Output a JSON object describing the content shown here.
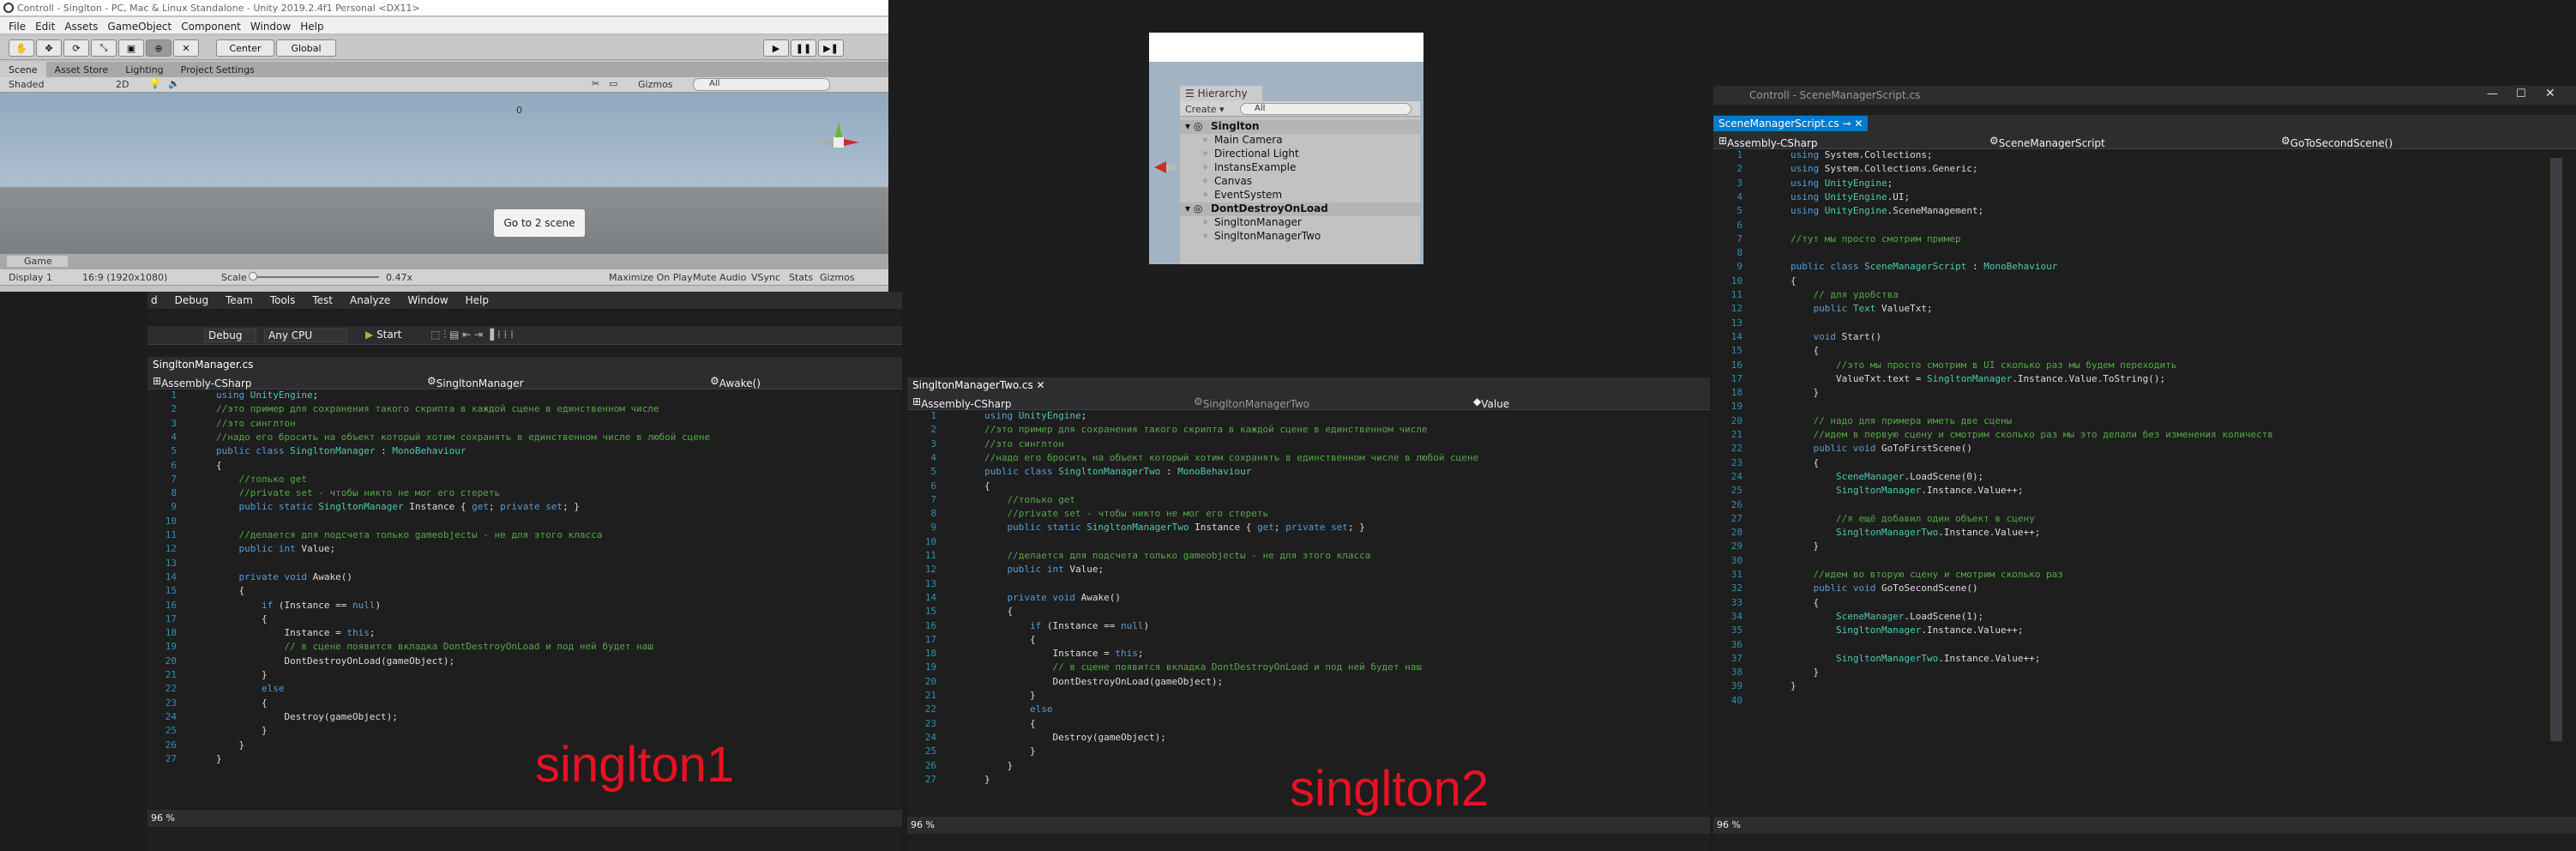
{
  "unity": {
    "title": "Controll - Singlton - PC, Mac & Linux Standalone - Unity 2019.2.4f1 Personal <DX11>",
    "menu": [
      "File",
      "Edit",
      "Assets",
      "GameObject",
      "Component",
      "Window",
      "Help"
    ],
    "toolbar": {
      "center": "Center",
      "global": "Global"
    },
    "tabs": [
      "Scene",
      "Asset Store",
      "Lighting",
      "Project Settings"
    ],
    "scene_bar": {
      "shaded": "Shaded",
      "mode2d": "2D",
      "gizmos": "Gizmos",
      "search": "All"
    },
    "scene_button": "Go to 2 scene",
    "scene_value": "0",
    "game_tab": "Game",
    "game_bar": {
      "display": "Display 1",
      "res": "16:9 (1920x1080)",
      "scale_label": "Scale",
      "scale_value": "0.47x",
      "max": "Maximize On Play",
      "mute": "Mute Audio",
      "vsync": "VSync",
      "stats": "Stats",
      "gizmos": "Gizmos"
    }
  },
  "hierarchy": {
    "title": "Hierarchy",
    "create": "Create",
    "search": "All",
    "items": [
      {
        "label": "Singlton",
        "level": 0,
        "scene": true
      },
      {
        "label": "Main Camera",
        "level": 1
      },
      {
        "label": "Directional Light",
        "level": 1
      },
      {
        "label": "InstansExample",
        "level": 1
      },
      {
        "label": "Canvas",
        "level": 1
      },
      {
        "label": "EventSystem",
        "level": 1
      },
      {
        "label": "DontDestroyOnLoad",
        "level": 0,
        "scene": true
      },
      {
        "label": "SingltonManager",
        "level": 1
      },
      {
        "label": "SingltonManagerTwo",
        "level": 1
      }
    ]
  },
  "vs1": {
    "menu": [
      "d",
      "Debug",
      "Team",
      "Tools",
      "Test",
      "Analyze",
      "Window",
      "Help"
    ],
    "toolbar": {
      "config": "Debug",
      "platform": "Any CPU",
      "start": "Start"
    },
    "tab": "SingltonManager.cs",
    "nav": {
      "project": "Assembly-CSharp",
      "cls": "SingltonManager",
      "method": "Awake()"
    },
    "zoom": "96 %",
    "label": "singlton1",
    "lines": [
      "using UnityEngine;",
      "//это пример для сохранения такого скрипта в каждой сцене в единственном числе",
      "//это синглтон",
      "//надо его бросить на объект который хотим сохранять в единственном числе в любой сцене",
      "public class SingltonManager : MonoBehaviour",
      "{",
      "    //только get",
      "    //private set - чтобы никто не мог его стереть",
      "    public static SingltonManager Instance { get; private set; }",
      "",
      "    //делается для подсчета только gameobjectы - не для этого класса",
      "    public int Value;",
      "",
      "    private void Awake()",
      "    {",
      "        if (Instance == null)",
      "        {",
      "            Instance = this;",
      "            // в сцене появится вкладка DontDestroyOnLoad и под ней будет наш",
      "            DontDestroyOnLoad(gameObject);",
      "        }",
      "        else",
      "        {",
      "            Destroy(gameObject);",
      "        }",
      "    }",
      "}"
    ]
  },
  "vs2": {
    "tab": "SingltonManagerTwo.cs",
    "nav": {
      "project": "Assembly-CSharp",
      "cls": "SingltonManagerTwo",
      "method": "Value"
    },
    "zoom": "96 %",
    "label": "singlton2",
    "lines": [
      "using UnityEngine;",
      "//это пример для сохранения такого скрипта в каждой сцене в единственном числе",
      "//это синглтон",
      "//надо его бросить на объект который хотим сохранять в единственном числе в любой сцене",
      "public class SingltonManagerTwo : MonoBehaviour",
      "{",
      "    //только get",
      "    //private set - чтобы никто не мог его стереть",
      "    public static SingltonManagerTwo Instance { get; private set; }",
      "",
      "    //делается для подсчета только gameobjectы - не для этого класса",
      "    public int Value;",
      "",
      "    private void Awake()",
      "    {",
      "        if (Instance == null)",
      "        {",
      "            Instance = this;",
      "            // в сцене появится вкладка DontDestroyOnLoad и под ней будет наш",
      "            DontDestroyOnLoad(gameObject);",
      "        }",
      "        else",
      "        {",
      "            Destroy(gameObject);",
      "        }",
      "    }",
      "}"
    ]
  },
  "vs3": {
    "title": "Controll - SceneManagerScript.cs",
    "tab": "SceneManagerScript.cs",
    "nav": {
      "project": "Assembly-CSharp",
      "cls": "SceneManagerScript",
      "method": "GoToSecondScene()"
    },
    "zoom": "96 %",
    "lines": [
      "using System.Collections;",
      "using System.Collections.Generic;",
      "using UnityEngine;",
      "using UnityEngine.UI;",
      "using UnityEngine.SceneManagement;",
      "",
      "//тут мы просто смотрим пример",
      "",
      "public class SceneManagerScript : MonoBehaviour",
      "{",
      "    // для удобства",
      "    public Text ValueTxt;",
      "",
      "    void Start()",
      "    {",
      "        //это мы просто смотрим в UI сколько раз мы будем переходить",
      "        ValueTxt.text = SingltonManager.Instance.Value.ToString();",
      "    }",
      "",
      "    // надо для примера иметь две сцены",
      "    //идем в первую сцену и смотрим сколько раз мы это делали без изменения количеств",
      "    public void GoToFirstScene()",
      "    {",
      "        SceneManager.LoadScene(0);",
      "        SingltonManager.Instance.Value++;",
      "",
      "        //я ещё добавил один объект в сцену",
      "        SingltonManagerTwo.Instance.Value++;",
      "    }",
      "",
      "    //идем во вторую сцену и смотрим сколько раз",
      "    public void GoToSecondScene()",
      "    {",
      "        SceneManager.LoadScene(1);",
      "        SingltonManager.Instance.Value++;",
      "",
      "        SingltonManagerTwo.Instance.Value++;",
      "    }",
      "}",
      ""
    ]
  },
  "colors": {
    "keyword": "#569cd6",
    "type": "#4ec9b0",
    "comment": "#57a64a",
    "string": "#d69d85",
    "linenumber": "#2b91af",
    "accent": "#007acc",
    "label": "#e81123"
  }
}
